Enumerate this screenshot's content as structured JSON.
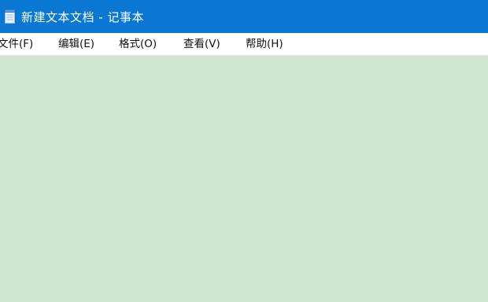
{
  "window": {
    "title": "新建文本文档 - 记事本",
    "icon": "notepad-icon",
    "titlebar_color": "#0a78d2",
    "editor_background": "#cde6cf"
  },
  "menubar": {
    "items": [
      {
        "label": "文件(F)"
      },
      {
        "label": "编辑(E)"
      },
      {
        "label": "格式(O)"
      },
      {
        "label": "查看(V)"
      },
      {
        "label": "帮助(H)"
      }
    ]
  },
  "editor": {
    "content": ""
  }
}
